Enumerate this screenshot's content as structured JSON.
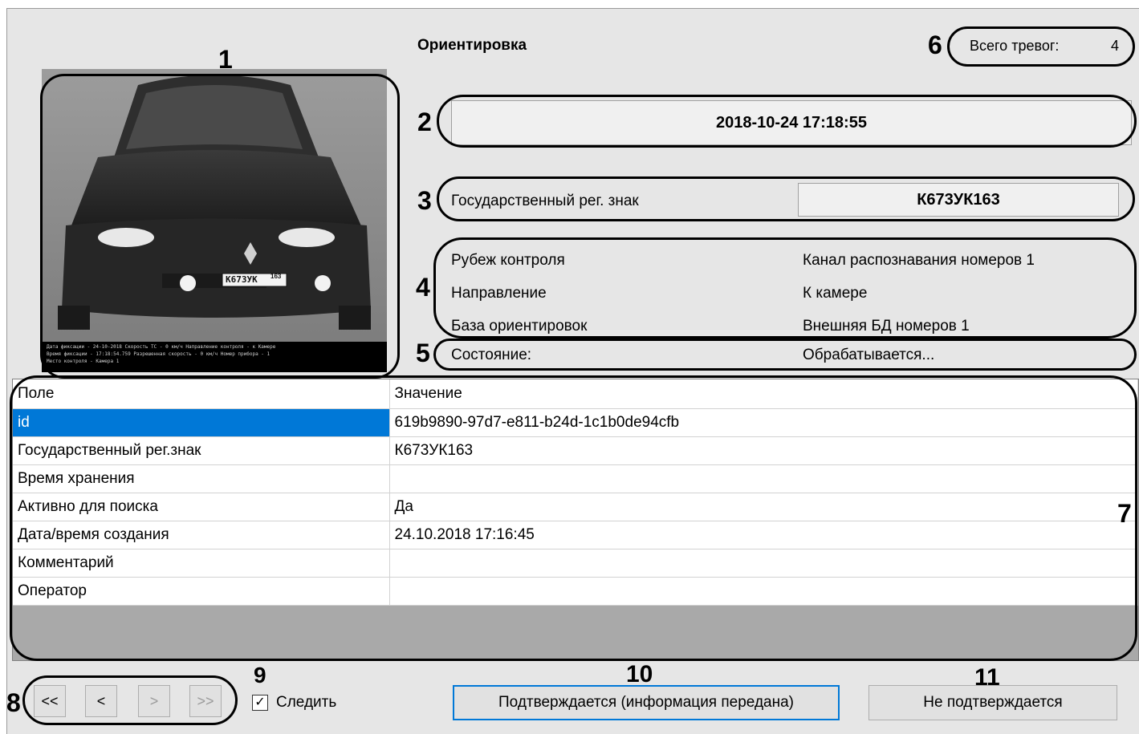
{
  "header": {
    "title": "Ориентировка",
    "total_alarms_label": "Всего тревог:",
    "total_alarms_value": "4"
  },
  "timestamp": "2018-10-24 17:18:55",
  "plate": {
    "label": "Государственный рег. знак",
    "value": "К673УК163"
  },
  "info": [
    {
      "label": "Рубеж контроля",
      "value": "Канал распознавания номеров 1"
    },
    {
      "label": "Направление",
      "value": "К камере"
    },
    {
      "label": "База ориентировок",
      "value": "Внешняя БД номеров 1"
    }
  ],
  "status": {
    "label": "Состояние:",
    "value": "Обрабатывается..."
  },
  "photo": {
    "plate_text": "К673УК",
    "plate_region": "163",
    "caption_lines": [
      "Дата фиксации - 24-10-2018  Скорость ТС - 0 км/ч  Направление контроля - к Камере",
      "Время фиксации - 17:18:54.759    Разрешенная скорость - 0 км/ч     Номер прибора - 1",
      "Место контроля - Камера 1"
    ]
  },
  "table": {
    "columns": [
      "Поле",
      "Значение"
    ],
    "rows": [
      {
        "field": "id",
        "value": "619b9890-97d7-e811-b24d-1c1b0de94cfb"
      },
      {
        "field": "Государственный рег.знак",
        "value": "К673УК163"
      },
      {
        "field": "Время хранения",
        "value": ""
      },
      {
        "field": "Активно для поиска",
        "value": "Да"
      },
      {
        "field": "Дата/время создания",
        "value": "24.10.2018 17:16:45"
      },
      {
        "field": "Комментарий",
        "value": ""
      },
      {
        "field": "Оператор",
        "value": ""
      }
    ]
  },
  "nav": {
    "first": "<<",
    "prev": "<",
    "next": ">",
    "last": ">>"
  },
  "follow": {
    "label": "Следить",
    "checked": true
  },
  "buttons": {
    "confirm": "Подтверждается (информация передана)",
    "reject": "Не подтверждается"
  },
  "callouts": [
    "1",
    "2",
    "3",
    "4",
    "5",
    "6",
    "7",
    "8",
    "9",
    "10",
    "11"
  ],
  "colors": {
    "selection": "#0078d7",
    "window_bg": "#e6e6e6",
    "grid_empty": "#a9a9a9"
  }
}
